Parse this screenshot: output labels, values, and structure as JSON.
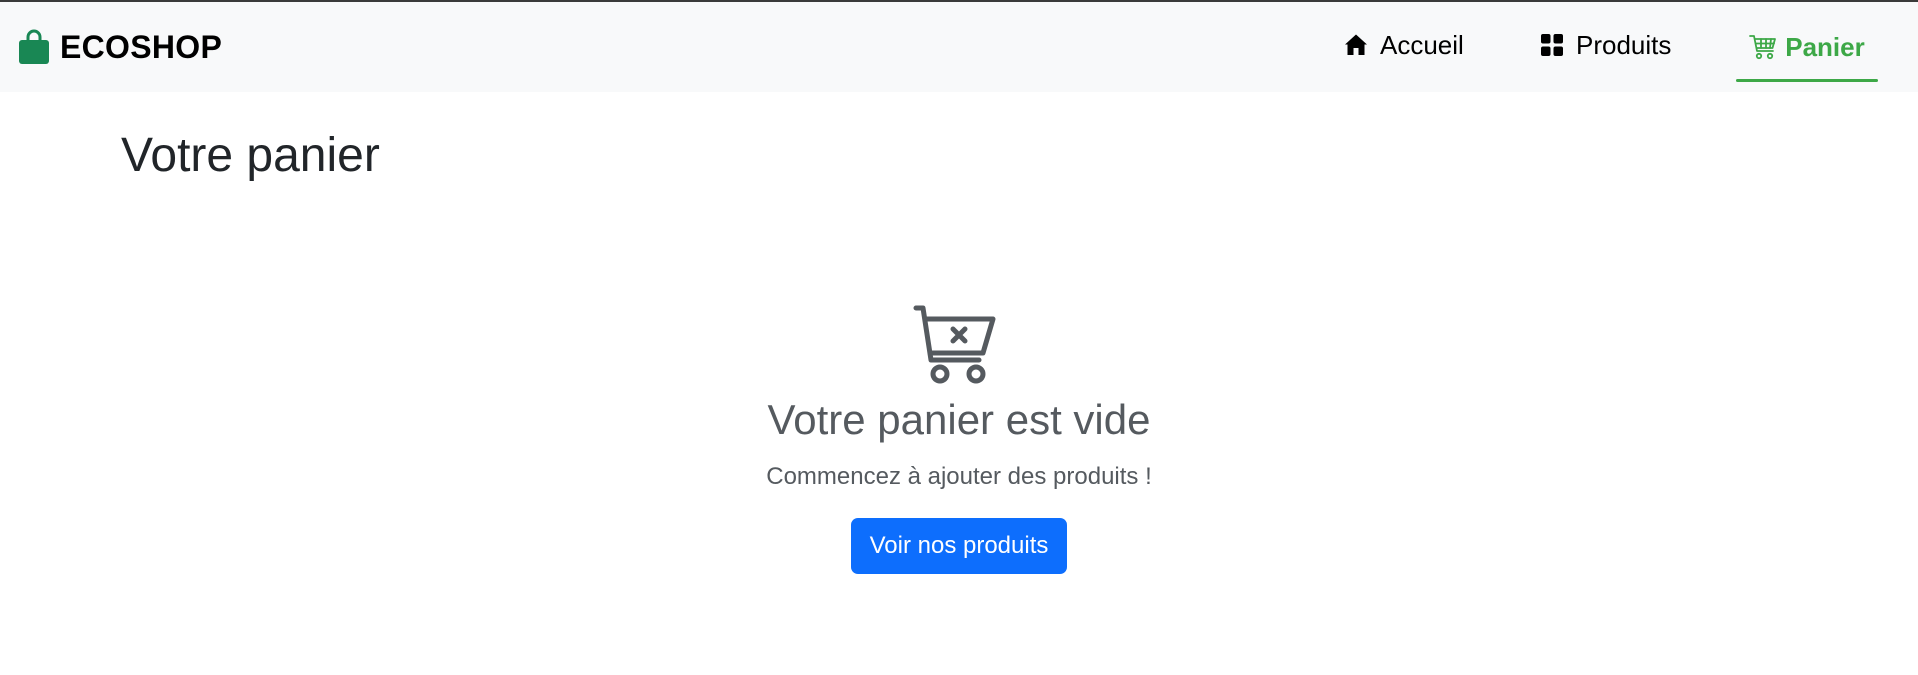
{
  "navbar": {
    "brand": {
      "text": "ECOSHOP",
      "icon": "shopping-bag-icon",
      "icon_color": "#198754"
    },
    "items": [
      {
        "label": "Accueil",
        "icon": "house-icon",
        "active": false
      },
      {
        "label": "Produits",
        "icon": "grid-icon",
        "active": false
      },
      {
        "label": "Panier",
        "icon": "cart-icon",
        "active": true
      }
    ],
    "active_color": "#3da847"
  },
  "page": {
    "title": "Votre panier"
  },
  "empty_state": {
    "icon": "cart-x-icon",
    "title": "Votre panier est vide",
    "subtitle": "Commencez à ajouter des produits !",
    "button_label": "Voir nos produits",
    "button_color": "#0d6efd"
  }
}
